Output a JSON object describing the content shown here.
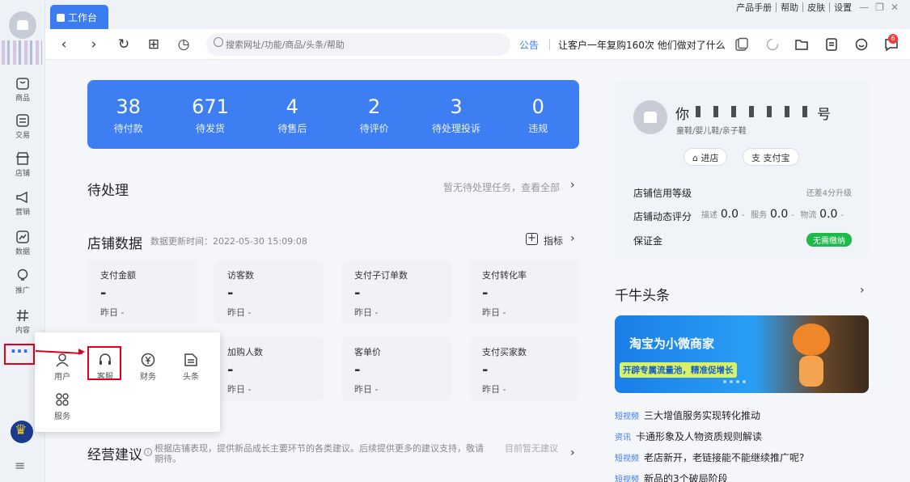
{
  "tabbar": {
    "active_tab": "工作台",
    "links": [
      "产品手册",
      "帮助",
      "皮肤",
      "设置"
    ]
  },
  "toolbar": {
    "search_placeholder": "搜索网址/功能/商品/头条/帮助",
    "announce_tag": "公告",
    "announce_text": "让客户一年复购160次 他们做对了什么",
    "message_badge": "6"
  },
  "sidebar": {
    "items": [
      {
        "label": "商品",
        "icon": "product-icon"
      },
      {
        "label": "交易",
        "icon": "trade-icon"
      },
      {
        "label": "店铺",
        "icon": "shop-icon"
      },
      {
        "label": "营销",
        "icon": "megaphone-icon"
      },
      {
        "label": "数据",
        "icon": "data-chart-icon"
      },
      {
        "label": "推广",
        "icon": "bulb-icon"
      },
      {
        "label": "内容",
        "icon": "hash-icon"
      }
    ],
    "more_label": "···"
  },
  "stats": [
    {
      "num": "38",
      "label": "待付款"
    },
    {
      "num": "671",
      "label": "待发货"
    },
    {
      "num": "4",
      "label": "待售后"
    },
    {
      "num": "2",
      "label": "待评价"
    },
    {
      "num": "3",
      "label": "待处理投诉"
    },
    {
      "num": "0",
      "label": "违规"
    }
  ],
  "pending": {
    "title": "待处理",
    "hint": "暂无待处理任务，查看全部"
  },
  "shop_data": {
    "title": "店铺数据",
    "update_time": "数据更新时间：2022-05-30 15:09:08",
    "indicator": "指标",
    "cards": [
      {
        "title": "支付金额",
        "value": "-",
        "yesterday": "昨日 -"
      },
      {
        "title": "访客数",
        "value": "-",
        "yesterday": "昨日 -"
      },
      {
        "title": "支付子订单数",
        "value": "-",
        "yesterday": "昨日 -"
      },
      {
        "title": "支付转化率",
        "value": "-",
        "yesterday": "昨日 -"
      },
      {
        "title": "加购人数",
        "value": "-",
        "yesterday": "昨日 -"
      },
      {
        "title": "客单价",
        "value": "-",
        "yesterday": "昨日 -"
      },
      {
        "title": "支付买家数",
        "value": "-",
        "yesterday": "昨日 -"
      }
    ]
  },
  "popup": {
    "items": [
      "用户",
      "客服",
      "财务",
      "头条",
      "服务"
    ]
  },
  "advice": {
    "title": "经营建议",
    "desc": "根据店铺表现，提供新品成长主要环节的各类建议。后续提供更多的建议支持，敬请期待。",
    "right": "目前暂无建议"
  },
  "shop": {
    "name_prefix": "你",
    "name_suffix": "号",
    "category": "童鞋/婴儿鞋/亲子鞋",
    "btn_enter": "进店",
    "btn_alipay": "支付宝",
    "credit_label": "店铺信用等级",
    "credit_hint": "还差4分升级",
    "dsr_label": "店铺动态评分",
    "dsr_desc": "描述",
    "dsr_desc_val": "0.0",
    "dsr_service": "服务",
    "dsr_service_val": "0.0",
    "dsr_logistics": "物流",
    "dsr_logistics_val": "0.0",
    "dash": "-",
    "deposit_label": "保证金",
    "deposit_badge": "无需缴纳"
  },
  "headlines": {
    "title": "千牛头条",
    "banner_title": "淘宝为小微商家",
    "banner_sub": "开辟专属流量池，精准促增长",
    "news": [
      {
        "tag": "短视频",
        "text": "三大增值服务实现转化推动"
      },
      {
        "tag": "资讯",
        "text": "卡通形象及人物资质规则解读"
      },
      {
        "tag": "短视频",
        "text": "老店新开，老链接能不能继续推广呢?"
      },
      {
        "tag": "短视频",
        "text": "新品的3个破局阶段"
      }
    ]
  },
  "colors": {
    "accent": "#3d7ff2",
    "highlight_red": "#e0001b",
    "green": "#1db94a"
  }
}
